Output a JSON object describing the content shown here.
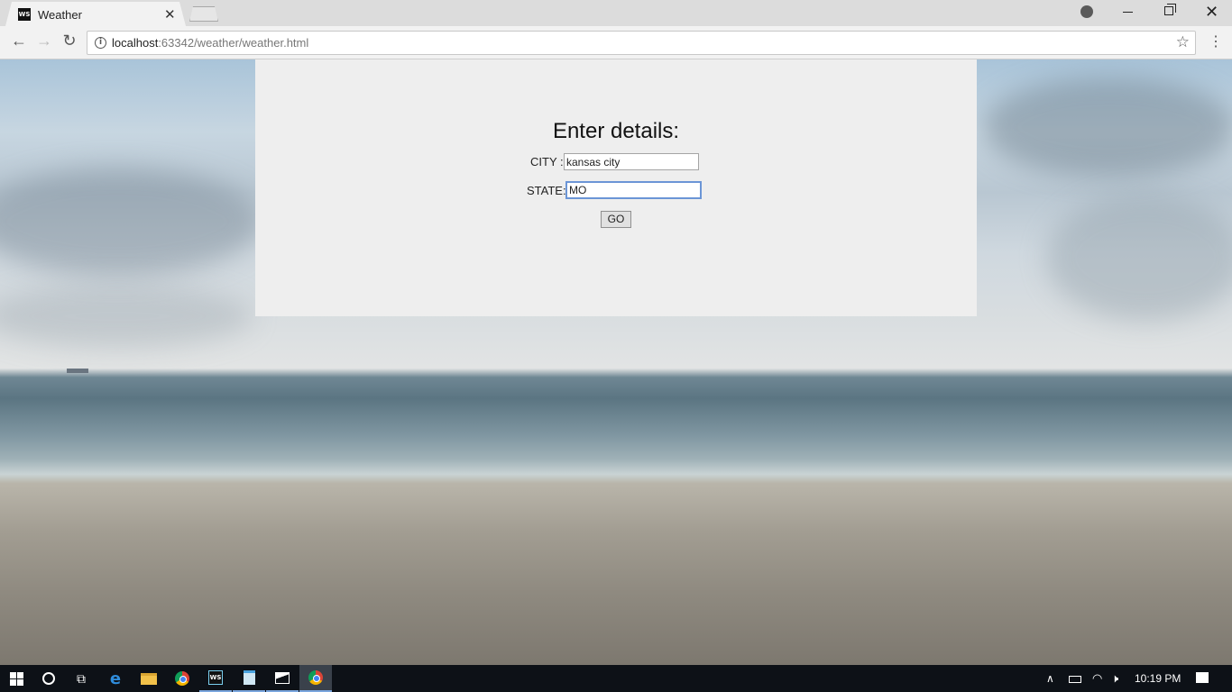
{
  "browser": {
    "tab_title": "Weather",
    "tab_favicon": "WS",
    "url_host": "localhost",
    "url_rest": ":63342/weather/weather.html"
  },
  "icons": {
    "back": "arrow-left-icon",
    "forward": "arrow-right-icon",
    "reload": "reload-icon",
    "info": "info-icon",
    "star": "star-icon",
    "menu": "menu-icon"
  },
  "form": {
    "title": "Enter details:",
    "city_label": "CITY :",
    "city_value": "kansas city",
    "state_label": "STATE:",
    "state_value": "MO",
    "go_label": "GO"
  },
  "taskbar": {
    "ws_icon_text": "WS",
    "clock": "10:19 PM"
  },
  "colors": {
    "panel": "#eeeeee",
    "focus_border": "#6b95d6",
    "taskbar": "#0d1117"
  }
}
